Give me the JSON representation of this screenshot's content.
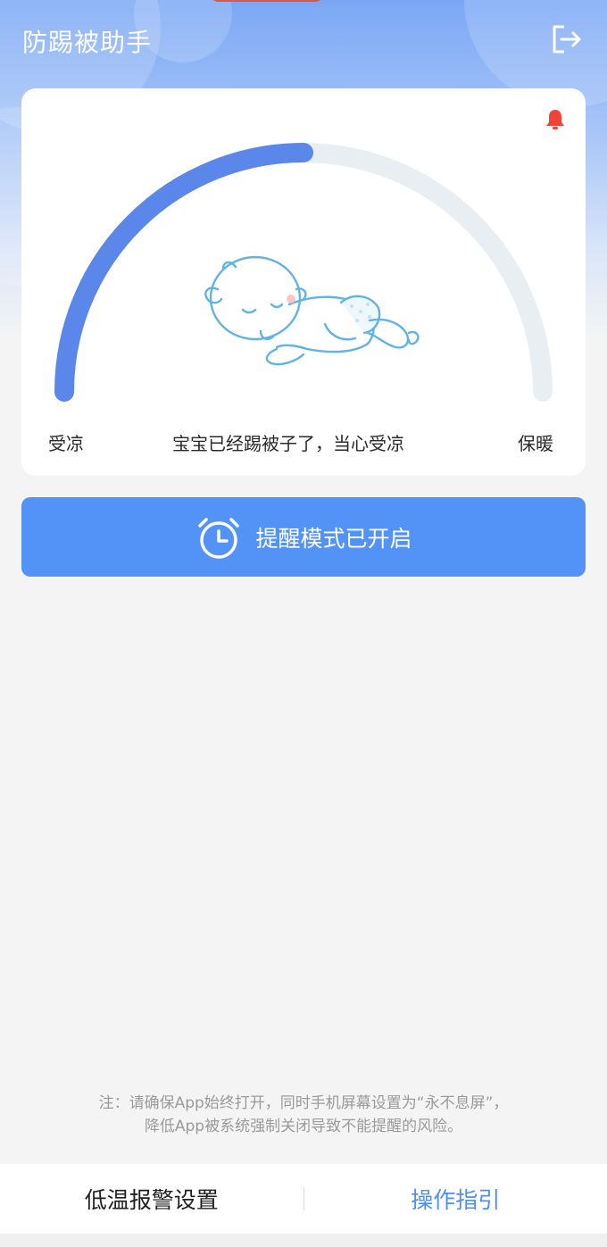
{
  "header": {
    "title": "防踢被助手",
    "logout_icon": "logout-icon"
  },
  "card": {
    "alert_icon": "bell-icon",
    "alert_color": "#f04438",
    "gauge": {
      "left_label": "受凉",
      "right_label": "保暖",
      "level": 0.5,
      "fill_color": "#5b86ea",
      "track_color": "#e9eef3"
    },
    "status_text": "宝宝已经踢被子了，当心受凉"
  },
  "reminder_button": {
    "icon": "alarm-clock-icon",
    "label": "提醒模式已开启",
    "color": "#5393f7"
  },
  "note": {
    "line1": "注：请确保App始终打开，同时手机屏幕设置为“永不息屏”，",
    "line2": "降低App被系统强制关闭导致不能提醒的风险。"
  },
  "bottom_nav": {
    "low_temp_alarm": "低温报警设置",
    "guide": "操作指引"
  }
}
